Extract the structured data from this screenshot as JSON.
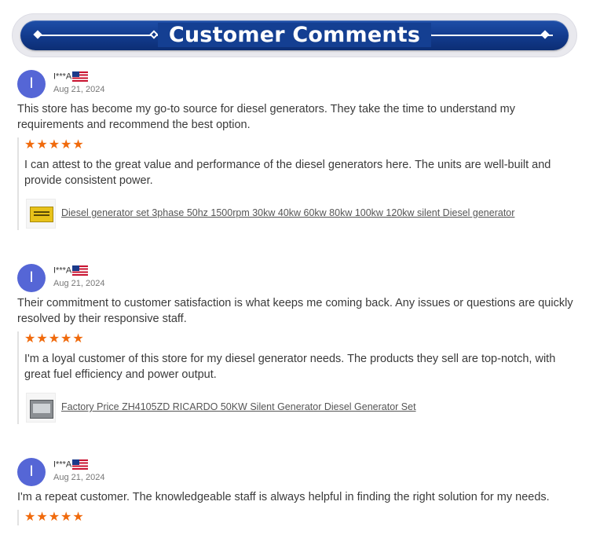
{
  "header": {
    "title": "Customer Comments"
  },
  "reviews": [
    {
      "avatar_initial": "I",
      "user": "I***A",
      "date": "Aug 21, 2024",
      "comment": "This store has become my go-to source for diesel generators. They take the time to understand my requirements and recommend the best option.",
      "stars": "★★★★★",
      "rating": 5,
      "reply": "I can attest to the great value and performance of the diesel generators here. The units are well-built and provide consistent power.",
      "product": "Diesel generator set 3phase 50hz 1500rpm 30kw 40kw 60kw 80kw 100kw 120kw silent Diesel generator"
    },
    {
      "avatar_initial": "I",
      "user": "I***A",
      "date": "Aug 21, 2024",
      "comment": "Their commitment to customer satisfaction is what keeps me coming back. Any issues or questions are quickly resolved by their responsive staff.",
      "stars": "★★★★★",
      "rating": 5,
      "reply": "I'm a loyal customer of this store for my diesel generator needs. The products they sell are top-notch, with great fuel efficiency and power output.",
      "product": "Factory Price ZH4105ZD RICARDO 50KW Silent Generator Diesel Generator Set"
    },
    {
      "avatar_initial": "I",
      "user": "I***A",
      "date": "Aug 21, 2024",
      "comment": "I'm a repeat customer. The knowledgeable staff is always helpful in finding the right solution for my needs.",
      "stars": "★★★★★",
      "rating": 5
    }
  ],
  "colors": {
    "banner": "#123a8c",
    "avatar": "#5566d6",
    "stars": "#f06a0c"
  }
}
